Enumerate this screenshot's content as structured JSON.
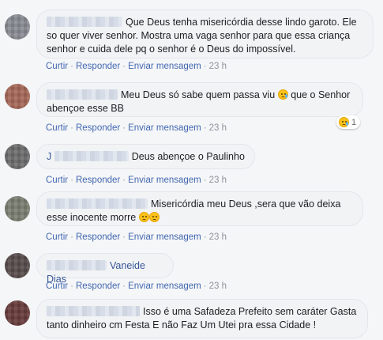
{
  "actions": {
    "like": "Curtir",
    "reply": "Responder",
    "message": "Enviar mensagem",
    "separator": "·"
  },
  "comments": [
    {
      "name": "",
      "text": "Que Deus tenha misericórdia desse lindo garoto. Ele so quer viver senhor. Mostra uma vaga senhor para que essa criança senhor e cuida dele pq o senhor é o Deus do impossível.",
      "time": "23 h"
    },
    {
      "name": "",
      "text": "Meu Deus só sabe quem passa viu",
      "text2": "que o Senhor abençoe esse BB",
      "time": "23 h",
      "reaction_count": "1"
    },
    {
      "name": "J",
      "text": "Deus abençoe o Paulinho",
      "time": "23 h"
    },
    {
      "name": "",
      "text": "Misericórdia meu Deus ,sera que vão deixa esse inocente morre",
      "time": "23 h"
    },
    {
      "name": "Vaneide Dias",
      "text": "",
      "time": "23 h"
    },
    {
      "name": "",
      "text": "Isso é uma Safadeza Prefeito sem caráter Gasta tanto dinheiro cm Festa E não Faz Um Utei pra essa Cidade !",
      "time": ""
    }
  ],
  "colors": {
    "background": "#f5f6f7",
    "bubble": "#f2f3f5",
    "link": "#4267b2",
    "name": "#385898"
  },
  "icons": [
    "crying-face-icon",
    "disappointed-face-icon"
  ]
}
